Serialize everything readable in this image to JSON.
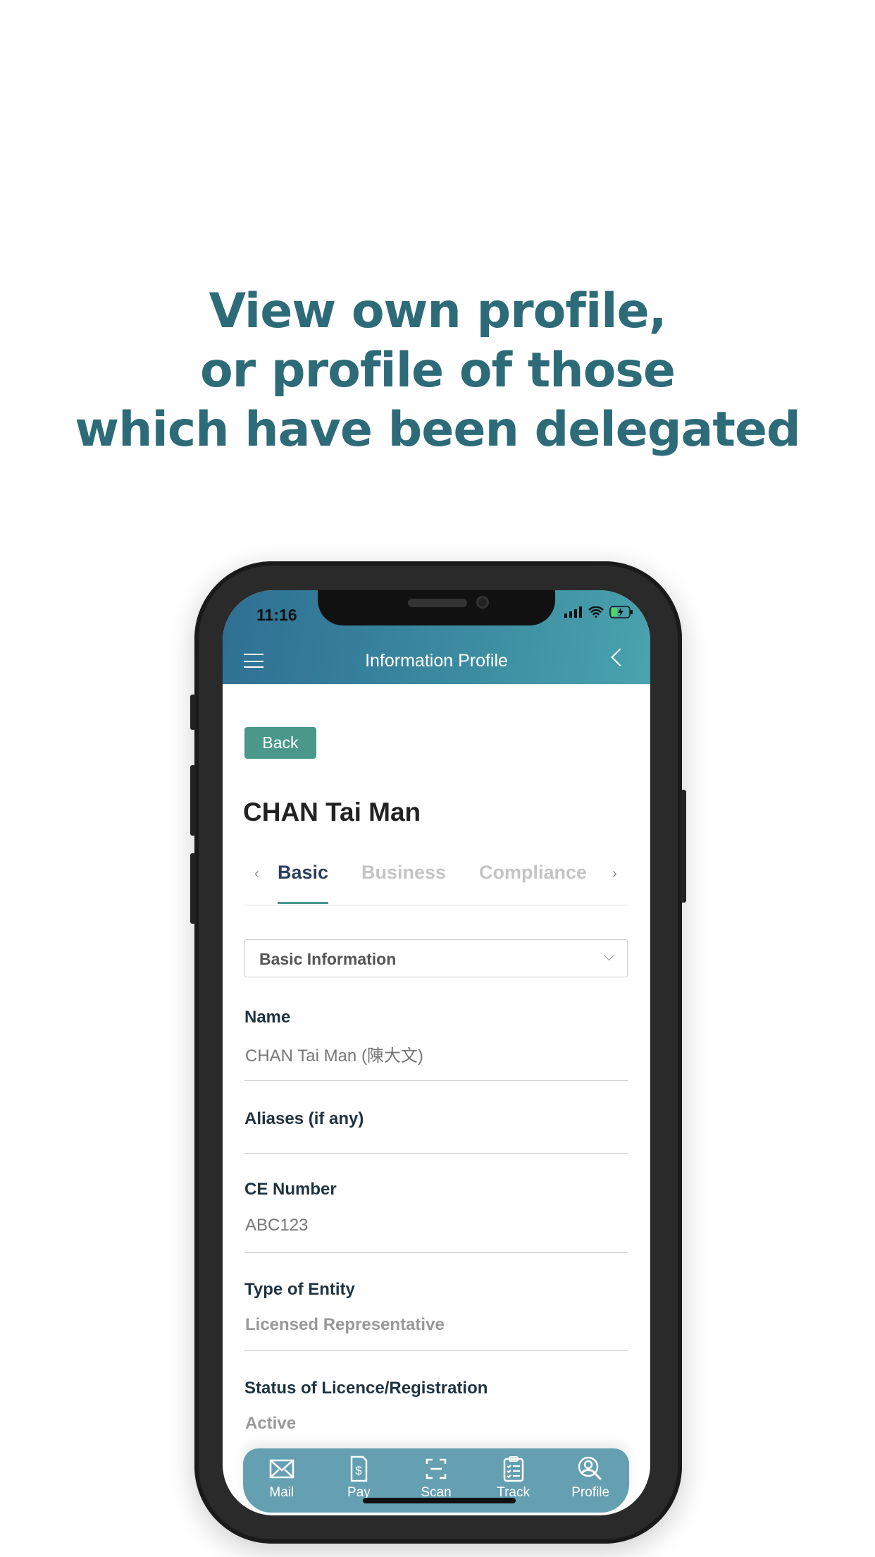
{
  "headline": {
    "line1": "View own profile,",
    "line2": "or profile of those",
    "line3": "which have been delegated"
  },
  "status_bar": {
    "time": "11:16"
  },
  "header": {
    "title": "Information Profile",
    "menu_icon": "hamburger-icon",
    "back_icon": "chevron-left-icon"
  },
  "back_label": "Back",
  "profile_name": "CHAN Tai Man",
  "tabs": [
    {
      "label": "Basic",
      "active": true
    },
    {
      "label": "Business",
      "active": false
    },
    {
      "label": "Compliance",
      "active": false
    }
  ],
  "section_select": {
    "value": "Basic Information"
  },
  "fields": [
    {
      "label": "Name",
      "value": "CHAN Tai Man (陳大文)"
    },
    {
      "label": "Aliases (if any)",
      "value": ""
    },
    {
      "label": "CE Number",
      "value": "ABC123"
    },
    {
      "label": "Type of Entity",
      "value": "Licensed Representative"
    },
    {
      "label": "Status of Licence/Registration",
      "value": "Active"
    }
  ],
  "nav": [
    {
      "label": "Mail",
      "icon": "mail-icon"
    },
    {
      "label": "Pay",
      "icon": "bill-dollar-icon"
    },
    {
      "label": "Scan",
      "icon": "scan-icon"
    },
    {
      "label": "Track",
      "icon": "clipboard-checklist-icon"
    },
    {
      "label": "Profile",
      "icon": "user-search-icon"
    }
  ],
  "colors": {
    "headline": "#2d6b78",
    "accent": "#4a988a",
    "nav": "#659fb2",
    "tab_active": "#2c3e5c"
  }
}
